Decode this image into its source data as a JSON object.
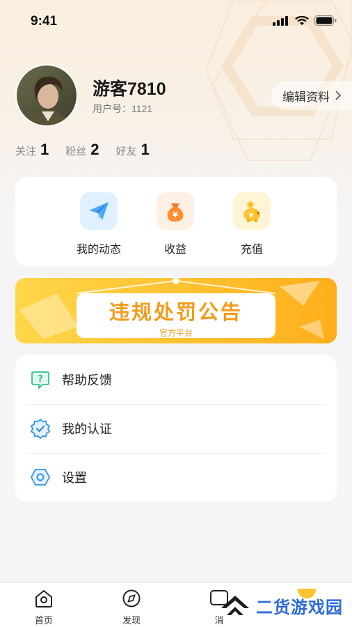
{
  "status_bar": {
    "time": "9:41"
  },
  "profile": {
    "username": "游客7810",
    "user_id": "用户号：1121",
    "edit_label": "编辑资料"
  },
  "stats": [
    {
      "label": "关注",
      "value": "1"
    },
    {
      "label": "粉丝",
      "value": "2"
    },
    {
      "label": "好友",
      "value": "1"
    }
  ],
  "quick_actions": [
    {
      "label": "我的动态",
      "icon": "paper-plane-icon"
    },
    {
      "label": "收益",
      "icon": "money-bag-icon"
    },
    {
      "label": "充值",
      "icon": "piggy-bank-icon"
    }
  ],
  "banner": {
    "title": "违规处罚公告",
    "subtitle": "官方平台"
  },
  "menu": [
    {
      "label": "帮助反馈",
      "icon": "help-chat-icon"
    },
    {
      "label": "我的认证",
      "icon": "verified-badge-icon"
    },
    {
      "label": "设置",
      "icon": "settings-hex-icon"
    }
  ],
  "tabbar": [
    {
      "label": "首页",
      "icon": "home-icon"
    },
    {
      "label": "发现",
      "icon": "compass-icon"
    },
    {
      "label": "消",
      "icon": "message-icon"
    }
  ],
  "watermark": {
    "text": "二货游戏园"
  },
  "colors": {
    "accent_orange": "#f29b1a",
    "banner_yellow": "#ffd64a",
    "menu_green": "#34c28a",
    "menu_blue": "#2e93e6",
    "watermark_blue": "#2d6bd6"
  }
}
